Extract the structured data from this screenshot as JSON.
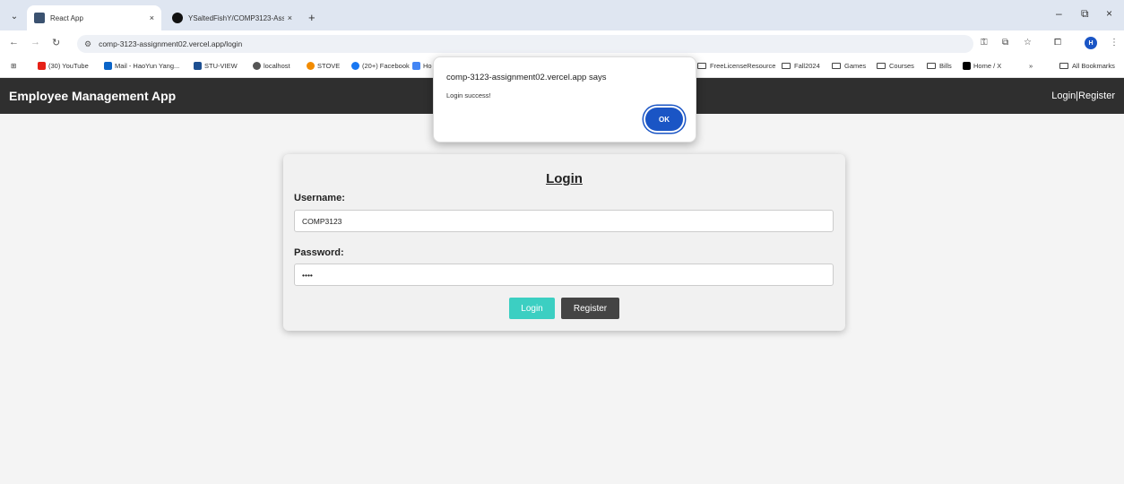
{
  "browser": {
    "tabs": [
      {
        "title": "React App",
        "close": "×"
      },
      {
        "title": "YSaltedFishY/COMP3123-Assig",
        "close": "×"
      }
    ],
    "new_tab": "+",
    "url": "comp-3123-assignment02.vercel.app/login",
    "window_controls": {
      "minimize": "–",
      "restore": "⧉",
      "close": "×"
    },
    "profile_initial": "H",
    "bookmarks": {
      "apps": "⊞",
      "left": [
        "(30) YouTube",
        "Mail - HaoYun Yang...",
        "STU-VIEW",
        "localhost",
        "STOVE",
        "(20+) Facebook",
        "Ho"
      ],
      "right": [
        "FreeLicenseResource",
        "Fall2024",
        "Games",
        "Courses",
        "Bills",
        "Home / X"
      ],
      "overflow": "»",
      "all_bookmarks": "All Bookmarks"
    }
  },
  "app": {
    "brand": "Employee Management App",
    "nav_links": "Login|Register",
    "login_form": {
      "heading": "Login",
      "username_label": "Username:",
      "username_value": "COMP3123",
      "password_label": "Password:",
      "password_value": "••••",
      "login_button": "Login",
      "register_button": "Register"
    },
    "colors": {
      "nav_bg": "#2f2f2f",
      "login_btn": "#3ccfc2",
      "register_btn": "#444444",
      "page_bg": "#f4f4f4"
    }
  },
  "dialog": {
    "title": "comp-3123-assignment02.vercel.app says",
    "message": "Login success!",
    "ok_label": "OK",
    "accent": "#1a55c5"
  }
}
